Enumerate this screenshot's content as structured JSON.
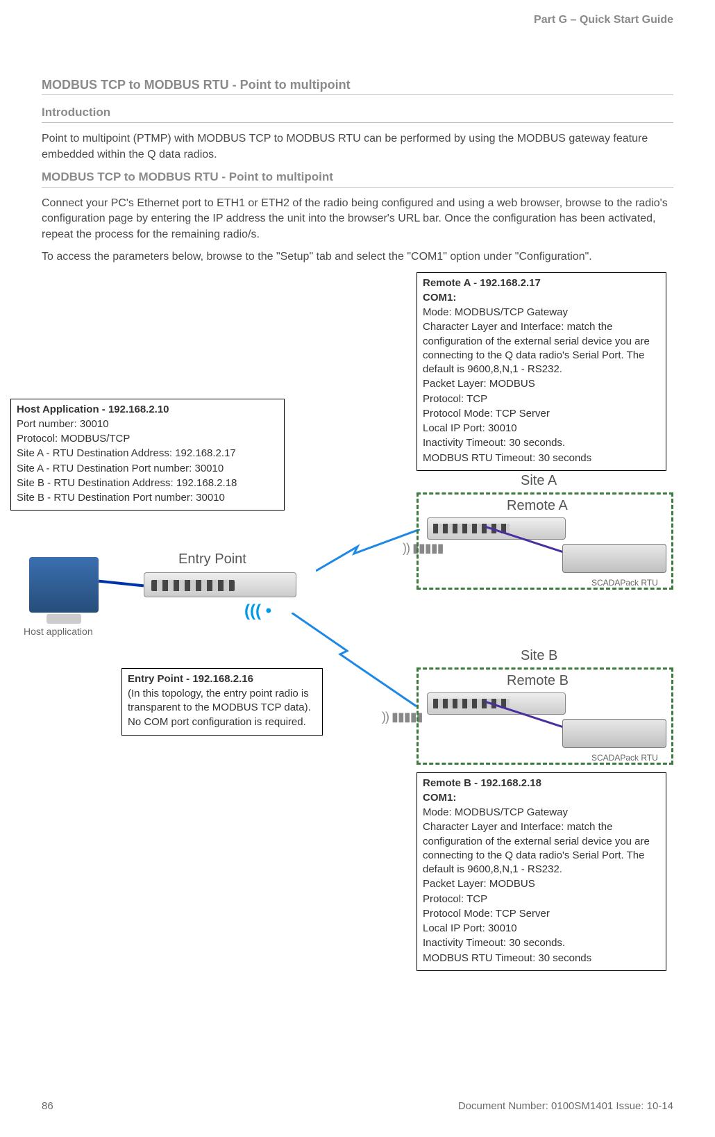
{
  "header": {
    "part": "Part G – Quick Start Guide"
  },
  "headings": {
    "h1": "MODBUS TCP to MODBUS RTU - Point to multipoint",
    "h2": "Introduction",
    "h3": "MODBUS TCP to MODBUS RTU - Point to multipoint"
  },
  "paragraphs": {
    "p1": "Point to multipoint (PTMP) with MODBUS TCP to MODBUS RTU can be performed by using the MODBUS gateway feature embedded within the Q data radios.",
    "p2": "Connect your PC's Ethernet port to ETH1 or ETH2 of the radio being configured and using a web browser, browse to the radio's configuration page by entering the IP address the unit into the browser's URL bar.  Once the configuration has been activated, repeat the process for the remaining radio/s.",
    "p3": "To access the parameters below, browse to the \"Setup\" tab and select the \"COM1\" option under \"Configuration\"."
  },
  "diagram": {
    "entry_point_label": "Entry Point",
    "host_label": "Host application",
    "siteA": {
      "title": "Site A",
      "remote": "Remote A",
      "rtu": "SCADAPack RTU"
    },
    "siteB": {
      "title": "Site B",
      "remote": "Remote B",
      "rtu": "SCADAPack RTU"
    }
  },
  "boxes": {
    "host": {
      "title": "Host Application - 192.168.2.10",
      "lines": [
        "Port number: 30010",
        "Protocol: MODBUS/TCP",
        "Site A - RTU Destination Address: 192.168.2.17",
        "Site A - RTU Destination Port number: 30010",
        "Site B - RTU Destination Address: 192.168.2.18",
        "Site B - RTU Destination Port number: 30010"
      ]
    },
    "entry": {
      "title": "Entry Point - 192.168.2.16",
      "lines": [
        "(In this topology, the entry point radio is transparent to the MODBUS TCP data).",
        "No COM port configuration is required."
      ]
    },
    "remoteA": {
      "title": "Remote A - 192.168.2.17",
      "com": "COM1:",
      "lines": [
        "Mode: MODBUS/TCP Gateway",
        "Character Layer and Interface: match the configuration of the external serial device you are connecting to the Q data radio's Serial Port. The default is 9600,8,N,1 - RS232.",
        "Packet Layer: MODBUS",
        "Protocol: TCP",
        "Protocol Mode: TCP Server",
        "Local IP Port: 30010",
        "Inactivity Timeout: 30 seconds.",
        "MODBUS RTU Timeout: 30 seconds"
      ]
    },
    "remoteB": {
      "title": "Remote B - 192.168.2.18",
      "com": "COM1:",
      "lines": [
        "Mode: MODBUS/TCP Gateway",
        "Character Layer and Interface: match the configuration of the external serial device you are connecting to the Q data radio's Serial Port. The default is 9600,8,N,1 - RS232.",
        "Packet Layer: MODBUS",
        "Protocol: TCP",
        "Protocol Mode: TCP Server",
        "Local IP Port: 30010",
        "Inactivity Timeout: 30 seconds.",
        "MODBUS RTU Timeout: 30 seconds"
      ]
    }
  },
  "footer": {
    "page": "86",
    "doc": "Document Number: 0100SM1401   Issue: 10-14"
  }
}
